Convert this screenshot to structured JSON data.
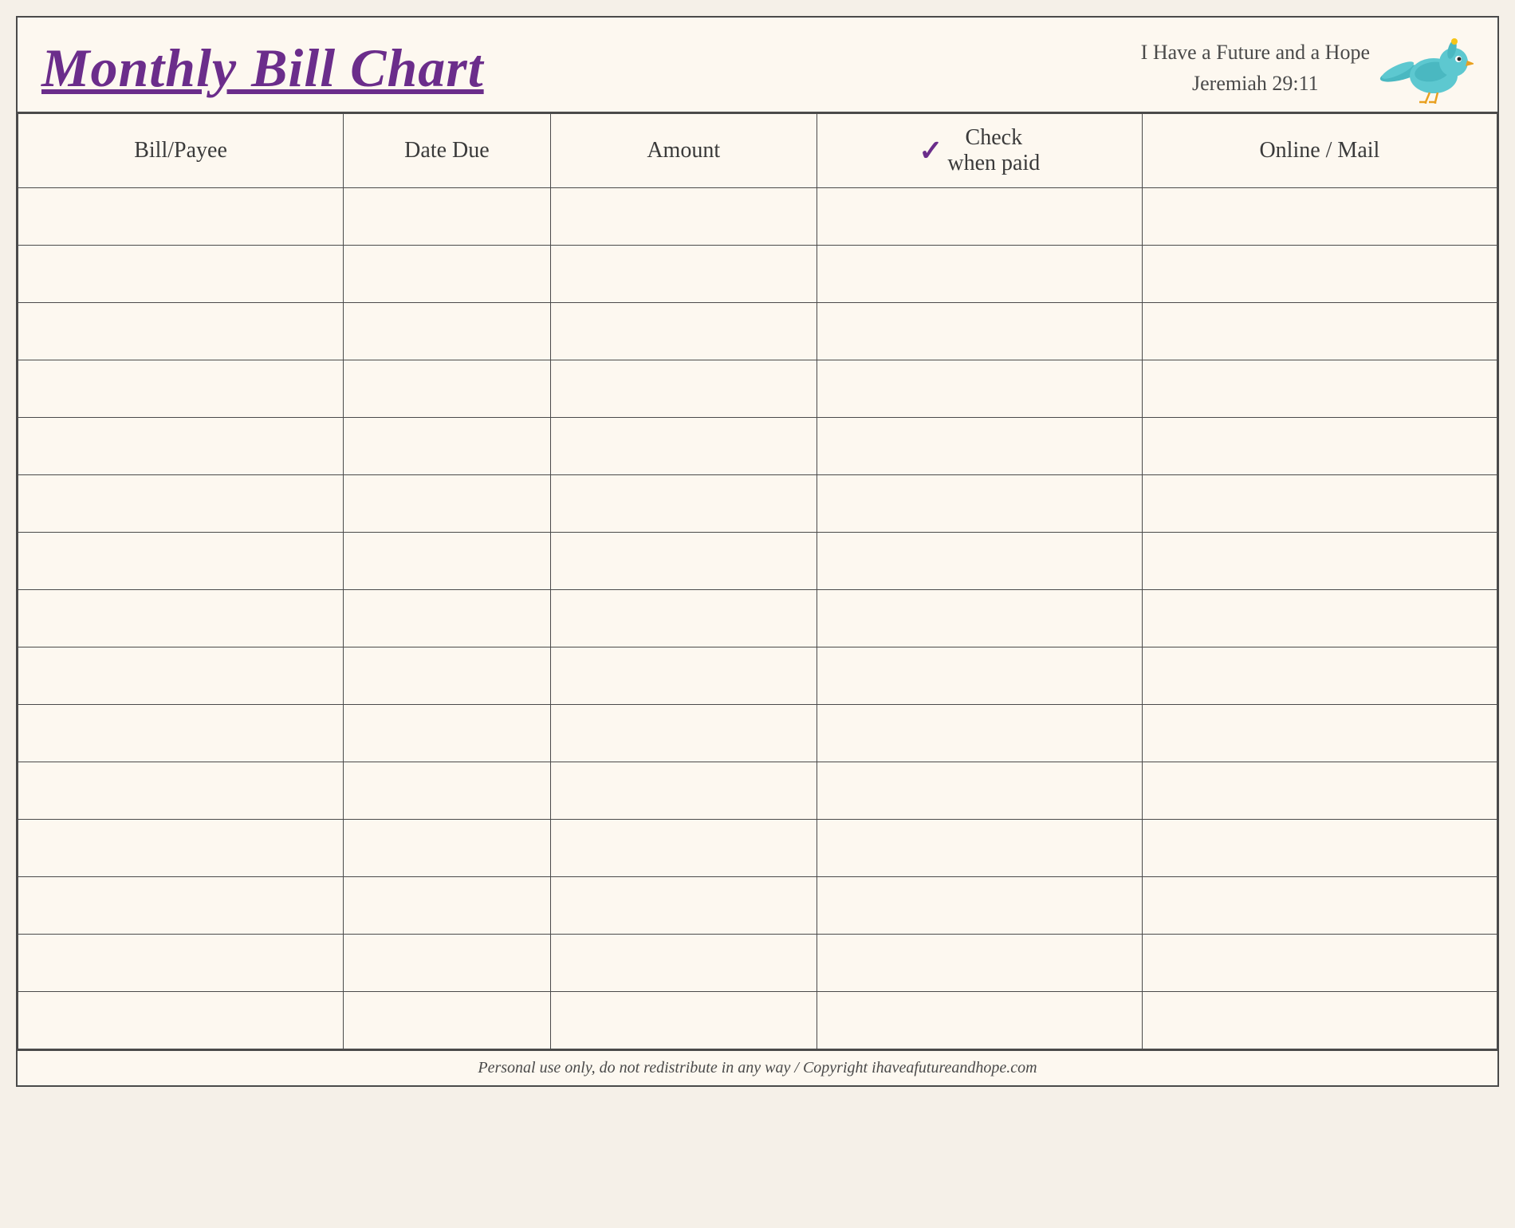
{
  "header": {
    "title": "Monthly Bill Chart",
    "subtitle_line1": "I Have a Future and a Hope",
    "subtitle_line2": "Jeremiah 29:11"
  },
  "table": {
    "columns": [
      {
        "id": "bill-payee",
        "label": "Bill/Payee"
      },
      {
        "id": "date-due",
        "label": "Date Due"
      },
      {
        "id": "amount",
        "label": "Amount"
      },
      {
        "id": "check-paid",
        "label": "Check\nwhen paid",
        "has_checkmark": true
      },
      {
        "id": "online-mail",
        "label": "Online / Mail"
      }
    ],
    "row_count": 15
  },
  "footer": {
    "text": "Personal use only, do not redistribute in any way / Copyright ihaveafutureandhope.com"
  }
}
